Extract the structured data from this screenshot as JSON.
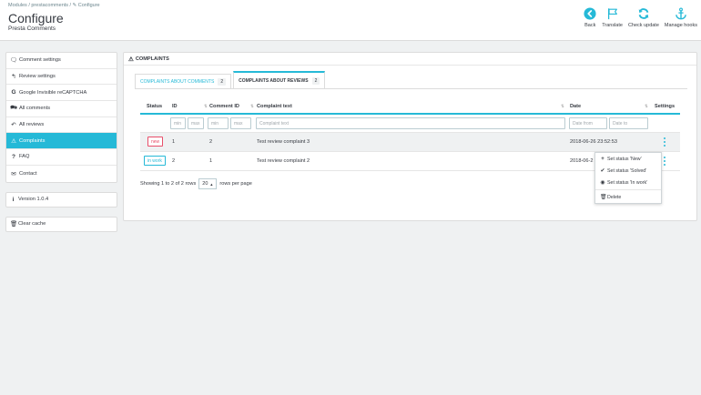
{
  "header": {
    "breadcrumb": "Modules  /  prestacomments  /  ✎ Configure",
    "title": "Configure",
    "subtitle": "Presta Comments",
    "toolbar": [
      {
        "label": "Back",
        "icon": "arrow-left-circle-icon"
      },
      {
        "label": "Translate",
        "icon": "flag-icon"
      },
      {
        "label": "Check update",
        "icon": "refresh-icon"
      },
      {
        "label": "Manage hooks",
        "icon": "anchor-icon"
      }
    ]
  },
  "sidebar": {
    "items": [
      {
        "label": "Comment settings",
        "icon": "speech-bubble-icon",
        "active": false
      },
      {
        "label": "Review settings",
        "icon": "reply-icon",
        "active": false
      },
      {
        "label": "Google Invisible reCAPTCHA",
        "icon": "google-icon",
        "active": false
      },
      {
        "label": "All comments",
        "icon": "comments-icon",
        "active": false
      },
      {
        "label": "All reviews",
        "icon": "reply-all-icon",
        "active": false
      },
      {
        "label": "Complaints",
        "icon": "warning-icon",
        "active": true
      },
      {
        "label": "FAQ",
        "icon": "question-icon",
        "active": false
      },
      {
        "label": "Contact",
        "icon": "envelope-icon",
        "active": false
      }
    ],
    "version": "Version 1.0.4",
    "clear_cache": "Clear cache"
  },
  "panel": {
    "heading": "COMPLAINTS",
    "tabs": [
      {
        "label": "COMPLAINTS ABOUT COMMENTS",
        "count": "2",
        "active": false
      },
      {
        "label": "COMPLAINTS ABOUT REVIEWS",
        "count": "2",
        "active": true
      }
    ],
    "table": {
      "columns": {
        "status": "Status",
        "id": "ID",
        "comment_id": "Comment ID",
        "text": "Complaint text",
        "date": "Date",
        "settings": "Settings"
      },
      "filters": {
        "min": "min",
        "max": "max",
        "text": "Complaint text",
        "date_from": "Date from",
        "date_to": "Date to"
      },
      "rows": [
        {
          "status": "new",
          "id": "1",
          "comment_id": "2",
          "text": "Test review complaint 3",
          "date": "2018-06-26 23:52:53"
        },
        {
          "status": "in work",
          "id": "2",
          "comment_id": "1",
          "text": "Test review complaint 2",
          "date": "2018-06-2"
        }
      ]
    },
    "pagination": {
      "showing": "Showing 1 to 2 of 2 rows",
      "per_page": "20",
      "rows_per_page": "rows per page"
    },
    "dropdown": [
      {
        "label": "Set status 'New'",
        "icon": "plus-icon"
      },
      {
        "label": "Set status 'Solved'",
        "icon": "check-icon"
      },
      {
        "label": "Set status 'In work'",
        "icon": "eye-icon"
      },
      {
        "label": "Delete",
        "icon": "trash-icon"
      }
    ]
  },
  "colors": {
    "accent": "#25b9d7",
    "danger": "#e84e6a",
    "background": "#eff1f2"
  }
}
